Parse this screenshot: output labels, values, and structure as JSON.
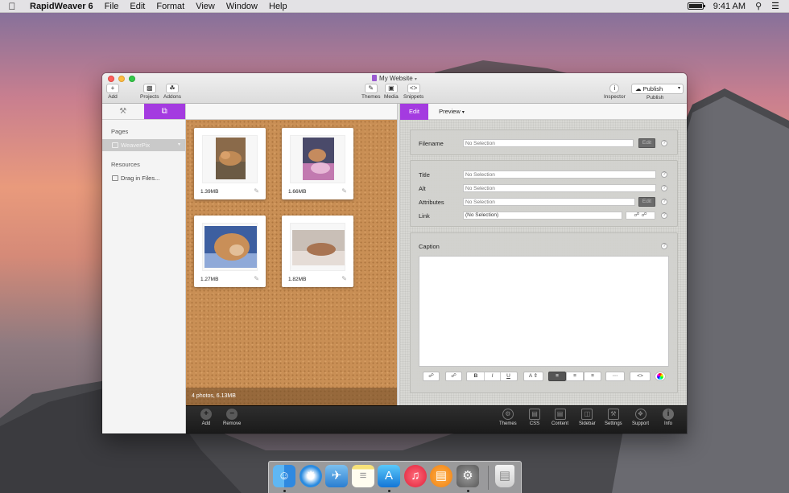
{
  "menubar": {
    "app_name": "RapidWeaver 6",
    "items": [
      "File",
      "Edit",
      "Format",
      "View",
      "Window",
      "Help"
    ],
    "clock": "9:41 AM"
  },
  "window": {
    "title": "My Website",
    "toolbar": {
      "add": "Add",
      "projects": "Projects",
      "addons": "Addons",
      "themes": "Themes",
      "media": "Media",
      "snippets": "Snippets",
      "inspector": "Inspector",
      "publish_button": "Publish",
      "publish_label": "Publish"
    }
  },
  "sidebar": {
    "pages_heading": "Pages",
    "page_item": "WeaverPix",
    "resources_heading": "Resources",
    "resource_item": "Drag in Files..."
  },
  "photos": {
    "items": [
      {
        "size": "1.39MB"
      },
      {
        "size": "1.66MB"
      },
      {
        "size": "1.27MB"
      },
      {
        "size": "1.82MB"
      }
    ],
    "status": "4 photos, 6.13MB"
  },
  "inspector": {
    "tabs": {
      "edit": "Edit",
      "preview": "Preview"
    },
    "filename_label": "Filename",
    "filename_placeholder": "No Selection",
    "edit_button": "Edit",
    "title_label": "Title",
    "title_placeholder": "No Selection",
    "alt_label": "Alt",
    "alt_placeholder": "No Selection",
    "attributes_label": "Attributes",
    "attributes_placeholder": "No Selection",
    "link_label": "Link",
    "link_value": "(No Selection)",
    "caption_label": "Caption",
    "help_glyph": "?"
  },
  "bottombar": {
    "add": "Add",
    "remove": "Remove",
    "themes": "Themes",
    "css": "CSS",
    "content": "Content",
    "sidebar": "Sidebar",
    "settings": "Settings",
    "support": "Support",
    "info": "Info"
  },
  "colors": {
    "accent_purple": "#a43be0",
    "cork": "#c98f55",
    "bottom_bar": "#1f1f1f"
  },
  "icons": {
    "menubar": [
      "apple-icon",
      "battery-icon",
      "spotlight-icon",
      "list-icon"
    ],
    "dock": [
      "finder-icon",
      "safari-icon",
      "mail-icon",
      "notes-icon",
      "appstore-icon",
      "itunes-icon",
      "ibooks-icon",
      "system-preferences-icon",
      "trash-icon"
    ]
  }
}
